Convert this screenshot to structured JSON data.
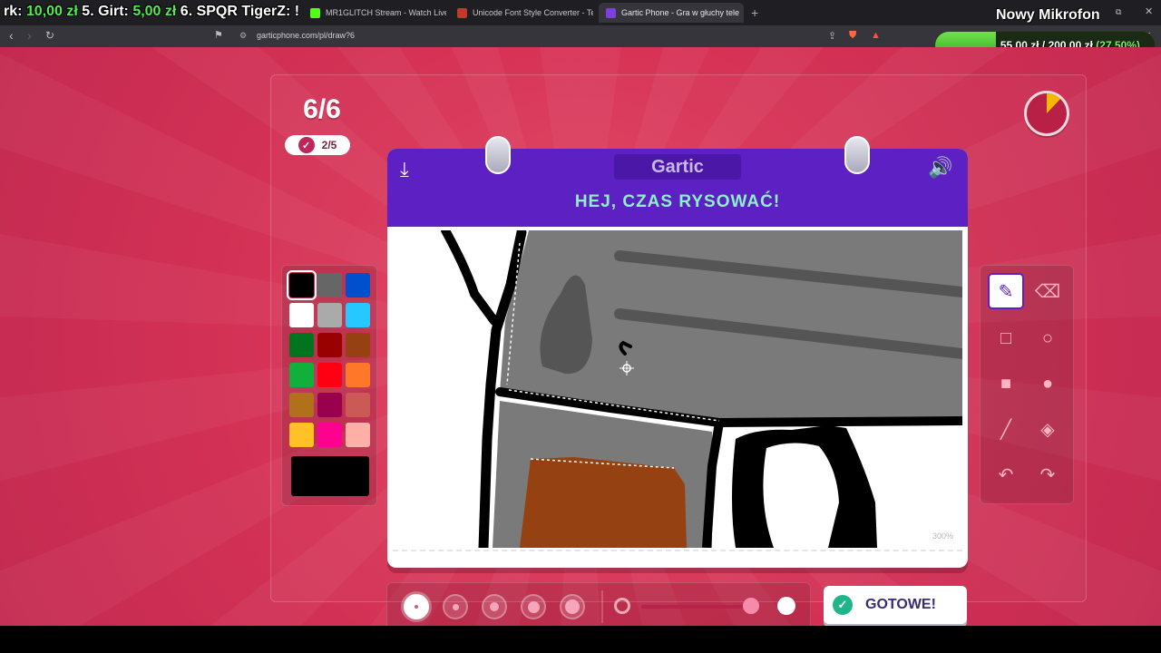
{
  "browser": {
    "ticker": {
      "prefix": "rk:",
      "amount1": "10,00 zł",
      "item2": "5. Girt:",
      "amount2": "5,00 zł",
      "item3": "6. SPQR TigerZ:",
      "suffix": "!"
    },
    "tabs": [
      {
        "label": "MR1GLITCH Stream - Watch Live on",
        "fav_color": "#53fc18"
      },
      {
        "label": "Unicode Font Style Converter - TextF",
        "fav_color": "#c0392b"
      },
      {
        "label": "Gartic Phone - Gra w głuchy tele",
        "fav_color": "#7b3fe4"
      }
    ],
    "new_tab": "+",
    "tab_close": "✕",
    "overlay_title": "Nowy Mikrofon",
    "url": "garticphone.com/pl/draw?6",
    "donation_goal": {
      "current": "55,00 zł",
      "separator": "/",
      "target": "200,00 zł",
      "percent_label": "(27.50%)",
      "fraction": 0.275
    }
  },
  "game": {
    "round": "6/6",
    "progress": "2/5",
    "logo": "Gartic",
    "heading": "HEJ, CZAS RYSOWAĆ!",
    "zoom": "300%",
    "timer_fraction_elapsed": 0.12,
    "palette": [
      [
        "#000000",
        "#666666",
        "#0050cd"
      ],
      [
        "#ffffff",
        "#aaaaaa",
        "#26c9ff"
      ],
      [
        "#017420",
        "#990000",
        "#964112"
      ],
      [
        "#11b03c",
        "#ff0013",
        "#ff7829"
      ],
      [
        "#b0701c",
        "#99004e",
        "#cb5a57"
      ],
      [
        "#ffc126",
        "#ff008f",
        "#feafa8"
      ]
    ],
    "selected_color": "#000000",
    "brush_sizes": 5,
    "selected_size": 0,
    "opacity_fraction": 0.93,
    "done_label": "GOTOWE!"
  }
}
